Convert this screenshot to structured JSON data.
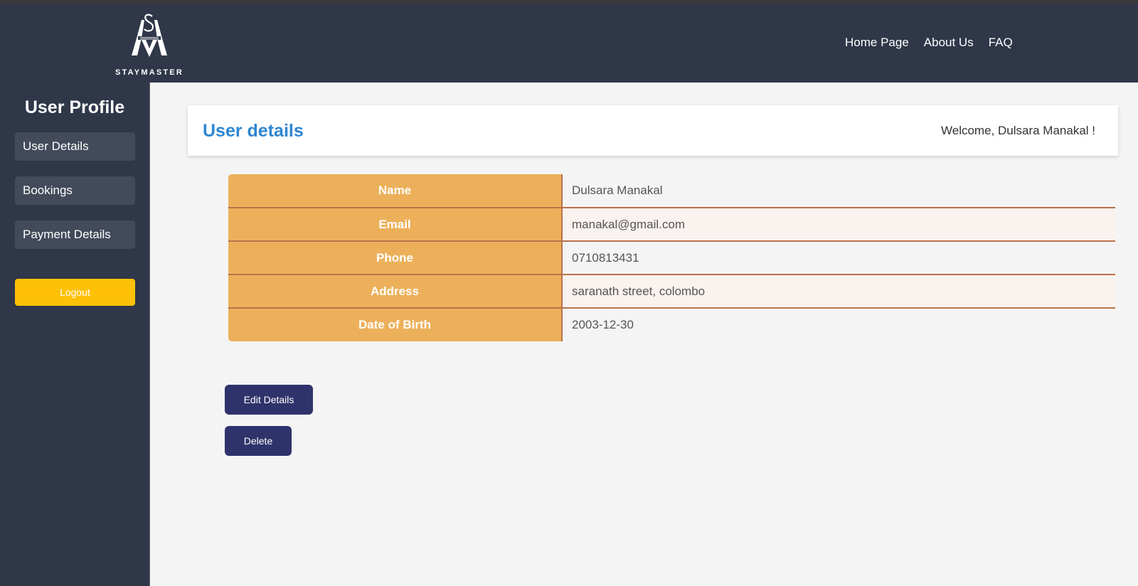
{
  "brand": {
    "logo_text": "STAYMASTER"
  },
  "nav": {
    "items": [
      "Home Page",
      "About Us",
      "FAQ"
    ]
  },
  "sidebar": {
    "title": "User Profile",
    "items": [
      "User Details",
      "Bookings",
      "Payment Details"
    ],
    "logout_label": "Logout"
  },
  "main": {
    "section_title": "User details",
    "welcome": "Welcome, Dulsara Manakal !",
    "details": [
      {
        "label": "Name",
        "value": "Dulsara Manakal"
      },
      {
        "label": "Email",
        "value": "manakal@gmail.com"
      },
      {
        "label": "Phone",
        "value": "0710813431"
      },
      {
        "label": "Address",
        "value": "saranath street, colombo"
      },
      {
        "label": "Date of Birth",
        "value": "2003-12-30"
      }
    ],
    "edit_label": "Edit Details",
    "delete_label": "Delete"
  },
  "colors": {
    "header_bg": "#2f3749",
    "accent_blue": "#2e86d1",
    "table_key_bg": "#edb05a",
    "button_bg": "#2f336b",
    "logout_bg": "#ffc107"
  }
}
